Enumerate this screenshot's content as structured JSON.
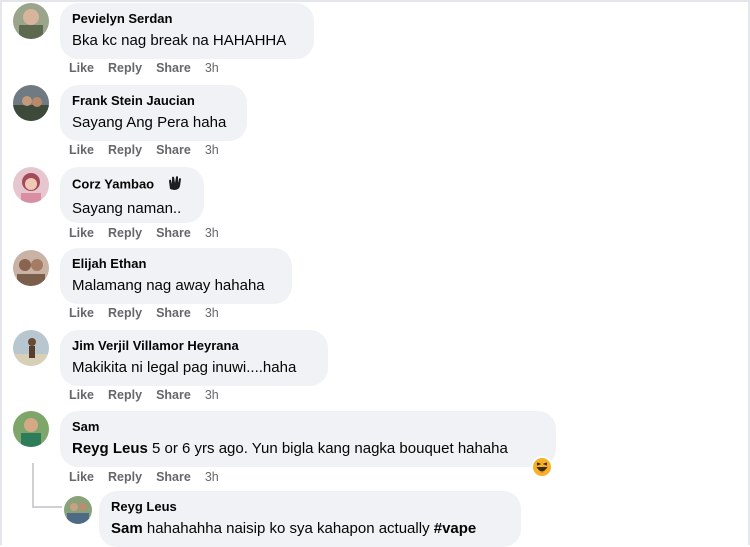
{
  "comments": [
    {
      "name": "Pevielyn Serdan",
      "text": "Bka kc nag break na HAHAHHA",
      "like": "Like",
      "reply": "Reply",
      "share": "Share",
      "time": "3h",
      "avatar": "avatar-photo"
    },
    {
      "name": "Frank Stein Jaucian",
      "text": "Sayang Ang Pera haha",
      "like": "Like",
      "reply": "Reply",
      "share": "Share",
      "time": "3h",
      "avatar": "avatar-photo"
    },
    {
      "name": "Corz Yambao",
      "text": "Sayang naman..",
      "like": "Like",
      "reply": "Reply",
      "share": "Share",
      "time": "3h",
      "avatar": "avatar-photo",
      "badge": "wave-hand-icon"
    },
    {
      "name": "Elijah Ethan",
      "text": "Malamang nag away hahaha",
      "like": "Like",
      "reply": "Reply",
      "share": "Share",
      "time": "3h",
      "avatar": "avatar-photo"
    },
    {
      "name": "Jim Verjil Villamor Heyrana",
      "text": "Makikita ni legal pag inuwi....haha",
      "like": "Like",
      "reply": "Reply",
      "share": "Share",
      "time": "3h",
      "avatar": "avatar-photo"
    },
    {
      "name": "Sam",
      "mention": "Reyg Leus",
      "text": " 5 or 6 yrs ago. Yun bigla kang nagka bouquet hahaha",
      "like": "Like",
      "reply": "Reply",
      "share": "Share",
      "time": "3h",
      "avatar": "avatar-photo",
      "reaction": "haha-reaction-icon"
    }
  ],
  "reply": {
    "name": "Reyg Leus",
    "mention": "Sam",
    "text": " hahahahha naisip ko sya kahapon actually ",
    "hashtag": "#vape",
    "avatar": "avatar-photo"
  },
  "colors": {
    "bubble": "#f0f2f5",
    "meta": "#65676b",
    "text": "#050505",
    "haha": "#f7b125"
  }
}
